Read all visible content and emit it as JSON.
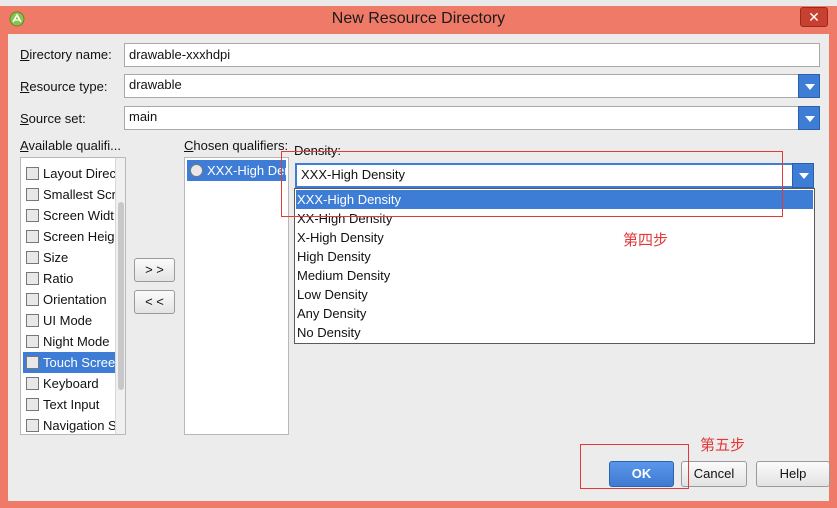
{
  "window": {
    "title": "New Resource Directory",
    "close_glyph": "✕",
    "accent": "#f07a68"
  },
  "form": {
    "directory_name": {
      "label": "Directory name:",
      "mnemonic": "D",
      "rest": "irectory name:",
      "value": "drawable-xxxhdpi"
    },
    "resource_type": {
      "label": "Resource type:",
      "mnemonic": "R",
      "rest": "esource type:",
      "value": "drawable"
    },
    "source_set": {
      "label": "Source set:",
      "mnemonic": "S",
      "rest": "ource set:",
      "value": "main"
    }
  },
  "available": {
    "label": "Available qualifi...",
    "mnemonic": "A",
    "rest": "vailable qualifi...",
    "items": [
      {
        "label": "Layout Direc",
        "icon": "layout-direction-icon",
        "selected": false
      },
      {
        "label": "Smallest Scr",
        "icon": "smallest-screen-icon",
        "selected": false
      },
      {
        "label": "Screen Widt",
        "icon": "screen-width-icon",
        "selected": false
      },
      {
        "label": "Screen Heig",
        "icon": "screen-height-icon",
        "selected": false
      },
      {
        "label": "Size",
        "icon": "size-icon",
        "selected": false
      },
      {
        "label": "Ratio",
        "icon": "ratio-icon",
        "selected": false
      },
      {
        "label": "Orientation",
        "icon": "orientation-icon",
        "selected": false
      },
      {
        "label": "UI Mode",
        "icon": "ui-mode-icon",
        "selected": false
      },
      {
        "label": "Night Mode",
        "icon": "night-mode-icon",
        "selected": false
      },
      {
        "label": "Touch Scree",
        "icon": "touch-screen-icon",
        "selected": true
      },
      {
        "label": "Keyboard",
        "icon": "keyboard-icon",
        "selected": false
      },
      {
        "label": "Text Input",
        "icon": "text-input-icon",
        "selected": false
      },
      {
        "label": "Navigation S",
        "icon": "navigation-icon",
        "selected": false
      }
    ]
  },
  "transfer": {
    "add": "> >",
    "remove": "< <"
  },
  "chosen": {
    "label": "Chosen qualifiers:",
    "mnemonic": "C",
    "rest": "hosen qualifiers:",
    "items": [
      {
        "label": "XXX-High Den",
        "icon": "density-icon",
        "selected": true
      }
    ]
  },
  "density": {
    "label": "Density:",
    "value": "XXX-High Density",
    "options": [
      {
        "label": "XXX-High Density",
        "selected": true
      },
      {
        "label": "XX-High Density",
        "selected": false
      },
      {
        "label": "X-High Density",
        "selected": false
      },
      {
        "label": "High Density",
        "selected": false
      },
      {
        "label": "Medium Density",
        "selected": false
      },
      {
        "label": "Low Density",
        "selected": false
      },
      {
        "label": "Any Density",
        "selected": false
      },
      {
        "label": "No Density",
        "selected": false
      }
    ]
  },
  "annotations": {
    "step4": "第四步",
    "step5": "第五步",
    "color": "#e23a3a"
  },
  "buttons": {
    "ok": "OK",
    "cancel": "Cancel",
    "help": "Help"
  }
}
